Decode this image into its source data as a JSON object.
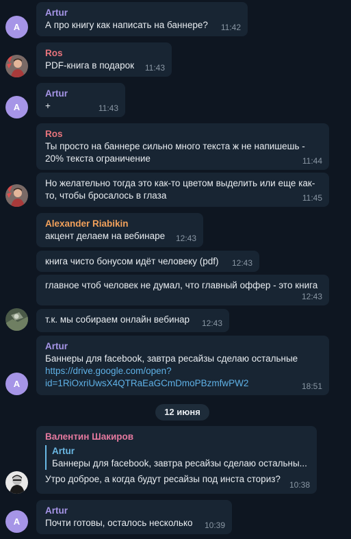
{
  "colors": {
    "background": "#0e1621",
    "bubble": "#182533",
    "artur": "#a695e7",
    "ros": "#e8747c",
    "alexander": "#f2a15b",
    "valentin": "#e5799f",
    "reply_accent": "#69b9e6",
    "link": "#5fb1e6"
  },
  "date_separator": "12 июня",
  "messages": [
    {
      "sender": "Artur",
      "text": "А про книгу как написать на баннере?",
      "time": "11:42",
      "avatar": "A"
    },
    {
      "sender": "Ros",
      "text": "PDF-книга в подарок",
      "time": "11:43",
      "avatar": "ros-photo-icon"
    },
    {
      "sender": "Artur",
      "text": "+",
      "time": "11:43",
      "avatar": "A"
    },
    {
      "sender": "Ros",
      "text": "Ты просто на баннере сильно много текста ж не напишешь -\n20% текста ограничение",
      "time": "11:44"
    },
    {
      "text": "Но желательно тогда это как-то цветом выделить или еще как-\nто, чтобы бросалось в глаза",
      "time": "11:45",
      "avatar": "ros-photo-icon"
    },
    {
      "sender": "Alexander Riabikin",
      "text": "акцент делаем на вебинаре",
      "time": "12:43"
    },
    {
      "text": "книга чисто бонусом идёт человеку (pdf)",
      "time": "12:43"
    },
    {
      "text": "главное чтоб человек не думал, что главный оффер - это книга",
      "time": "12:43"
    },
    {
      "text": "т.к. мы собираем онлайн вебинар",
      "time": "12:43",
      "avatar": "alexander-photo-icon"
    },
    {
      "sender": "Artur",
      "text": "Баннеры для facebook, завтра ресайзы сделаю остальные",
      "link": "https://drive.google.com/open?\nid=1RiOxriUwsX4QTRaEaGCmDmoPBzmfwPW2",
      "time": "18:51",
      "avatar": "A"
    },
    {
      "sender": "Валентин Шакиров",
      "reply_name": "Artur",
      "reply_text": "Баннеры для facebook, завтра ресайзы сделаю остальны...",
      "text": "Утро доброе, а когда будут ресайзы под инста сториз?",
      "time": "10:38",
      "avatar": "valentin-photo-icon"
    },
    {
      "sender": "Artur",
      "text": "Почти готовы, осталось несколько",
      "time": "10:39",
      "avatar": "A"
    }
  ]
}
